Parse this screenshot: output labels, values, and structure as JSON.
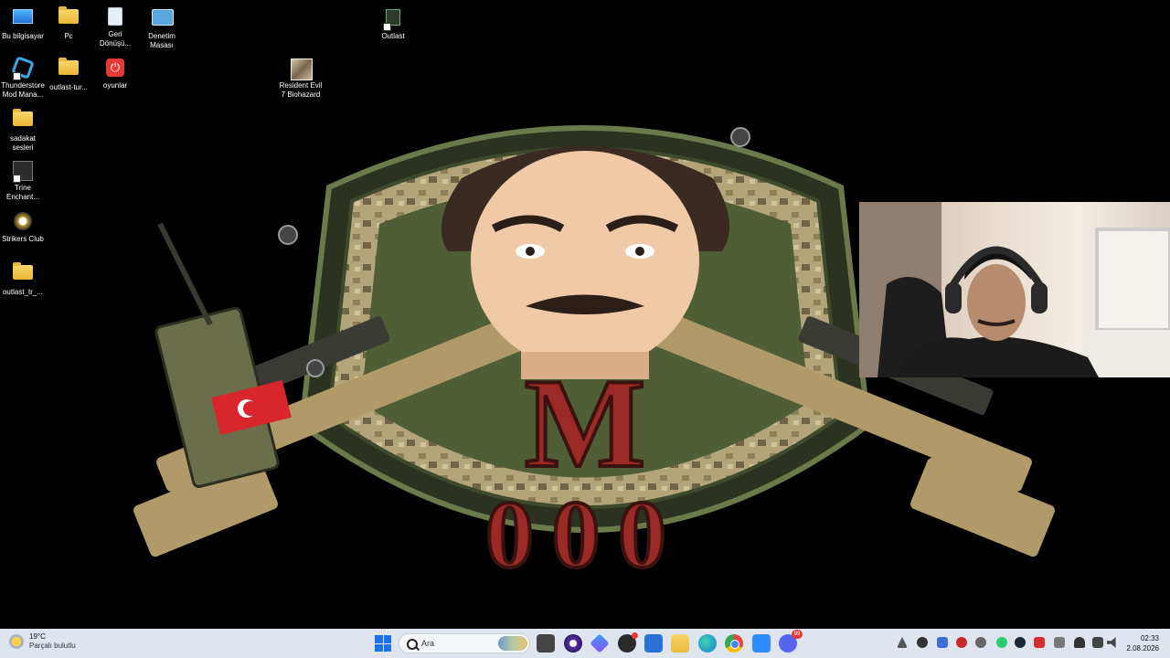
{
  "desktop": {
    "icons": [
      {
        "label": "Bu bilgisayar",
        "icon": "computer-icon"
      },
      {
        "label": "Pc",
        "icon": "folder-icon"
      },
      {
        "label": "Geri Dönüşü...",
        "icon": "recycle-bin-icon"
      },
      {
        "label": "Denetim Masası",
        "icon": "control-panel-icon"
      },
      {
        "label": "Outlast",
        "icon": "outlast-icon"
      },
      {
        "label": "Thunderstore Mod Mana...",
        "icon": "thunderstore-icon"
      },
      {
        "label": "outlast-tur...",
        "icon": "folder-icon"
      },
      {
        "label": "oyunlar",
        "icon": "power-icon"
      },
      {
        "label": "Resident Evil 7 Biohazard",
        "icon": "resident-evil-icon"
      },
      {
        "label": "sadakat sesleri",
        "icon": "folder-icon"
      },
      {
        "label": "Trine Enchant...",
        "icon": "trine-icon"
      },
      {
        "label": "Strikers Club",
        "icon": "strikers-club-icon"
      },
      {
        "label": "outlast_tr_...",
        "icon": "folder-icon"
      }
    ],
    "wallpaper": {
      "emblem_letter": "M",
      "emblem_number": "000",
      "colors": {
        "shield": "#4f5d35",
        "camo": "#a89a6e",
        "letter": "#9b2a26",
        "background": "#000000"
      }
    }
  },
  "taskbar": {
    "weather": {
      "temp": "19°C",
      "condition": "Parçalı bulutlu"
    },
    "search_placeholder": "Ara",
    "apps": [
      "start-icon",
      "task-view-icon",
      "cortana-icon",
      "copilot-icon",
      "app-icon",
      "store-icon",
      "file-explorer-icon",
      "edge-icon",
      "chrome-icon",
      "zoom-icon",
      "discord-icon"
    ],
    "discord_badge": "99",
    "clock": {
      "time": "02:33",
      "date": "2.08.2026"
    }
  }
}
